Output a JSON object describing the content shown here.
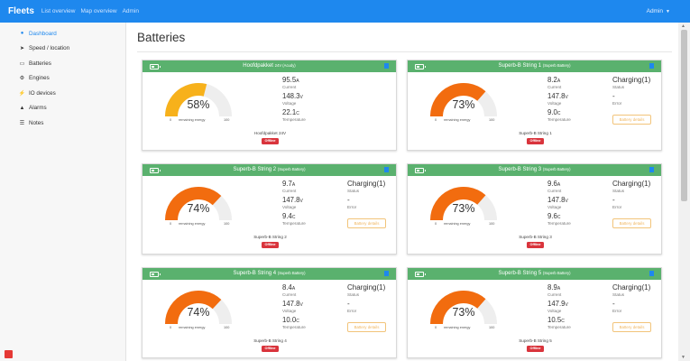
{
  "app": {
    "brand": "Fleets",
    "user_menu": "Admin"
  },
  "nav": [
    "List overview",
    "Map overview",
    "Admin"
  ],
  "sidebar": {
    "items": [
      {
        "label": "Dashboard",
        "icon": "dashboard-icon",
        "active": true
      },
      {
        "label": "Speed / location",
        "icon": "location-arrow-icon",
        "active": false
      },
      {
        "label": "Batteries",
        "icon": "battery-icon",
        "active": false
      },
      {
        "label": "Engines",
        "icon": "engine-cogs-icon",
        "active": false
      },
      {
        "label": "IO devices",
        "icon": "plug-icon",
        "active": false
      },
      {
        "label": "Alarms",
        "icon": "bell-icon",
        "active": false
      },
      {
        "label": "Notes",
        "icon": "list-icon",
        "active": false
      }
    ]
  },
  "page": {
    "title": "Batteries"
  },
  "labels": {
    "current": "Current",
    "voltage": "Voltage",
    "temperature": "Temperature",
    "status": "Status",
    "error": "Error",
    "remaining": "remaining energy",
    "gauge_min": "0",
    "gauge_max": "100",
    "details_button": "Battery details",
    "offline": "Offline"
  },
  "colors": {
    "header_green": "#5ab16e",
    "gauge_yellow": "#f7b11b",
    "gauge_orange": "#f26c0f",
    "gauge_track": "#eeeeee",
    "accent_blue": "#1e88ee",
    "offline_red": "#d9343c"
  },
  "batteries": [
    {
      "name": "Hoofdpakket",
      "sub": "24V (Acudy)",
      "percent": 58,
      "percent_label": "58%",
      "current": "95.5",
      "current_unit": "A",
      "voltage": "148.3",
      "voltage_unit": "V",
      "temperature": "22.1",
      "temp_unit": "C",
      "status": "",
      "error": "",
      "device": "Hoofdpakket 24V",
      "show_details": false
    },
    {
      "name": "Superb-B String 1",
      "sub": "(Superb Battery)",
      "percent": 73,
      "percent_label": "73%",
      "current": "8.2",
      "current_unit": "A",
      "voltage": "147.8",
      "voltage_unit": "V",
      "temperature": "9.0",
      "temp_unit": "C",
      "status": "Charging(1)",
      "error": "-",
      "device": "Superb-B String 1",
      "show_details": true
    },
    {
      "name": "Superb-B String 2",
      "sub": "(Superb Battery)",
      "percent": 74,
      "percent_label": "74%",
      "current": "9.7",
      "current_unit": "A",
      "voltage": "147.8",
      "voltage_unit": "V",
      "temperature": "9.4",
      "temp_unit": "C",
      "status": "Charging(1)",
      "error": "-",
      "device": "Superb-B String 2",
      "show_details": true
    },
    {
      "name": "Superb-B String 3",
      "sub": "(Superb Battery)",
      "percent": 73,
      "percent_label": "73%",
      "current": "9.6",
      "current_unit": "A",
      "voltage": "147.8",
      "voltage_unit": "V",
      "temperature": "9.6",
      "temp_unit": "C",
      "status": "Charging(1)",
      "error": "-",
      "device": "Superb-B String 3",
      "show_details": true
    },
    {
      "name": "Superb-B String 4",
      "sub": "(Superb Battery)",
      "percent": 74,
      "percent_label": "74%",
      "current": "8.4",
      "current_unit": "A",
      "voltage": "147.8",
      "voltage_unit": "V",
      "temperature": "10.0",
      "temp_unit": "C",
      "status": "Charging(1)",
      "error": "-",
      "device": "Superb-B String 4",
      "show_details": true
    },
    {
      "name": "Superb-B String 5",
      "sub": "(Superb Battery)",
      "percent": 73,
      "percent_label": "73%",
      "current": "8.9",
      "current_unit": "A",
      "voltage": "147.9",
      "voltage_unit": "V",
      "temperature": "10.5",
      "temp_unit": "C",
      "status": "Charging(1)",
      "error": "-",
      "device": "Superb-B String 5",
      "show_details": true
    }
  ]
}
